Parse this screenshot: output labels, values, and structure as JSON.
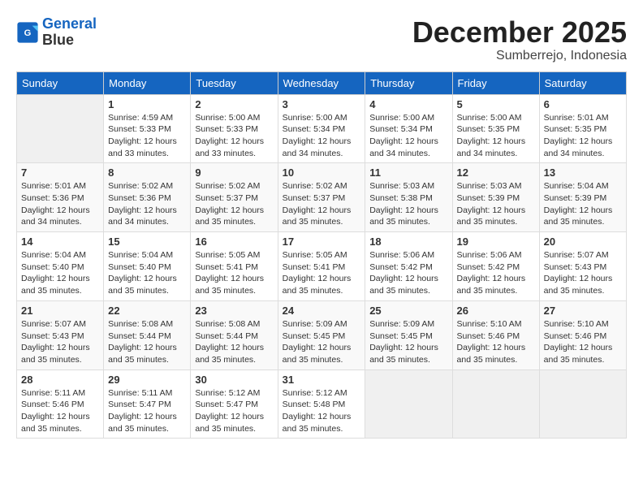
{
  "header": {
    "logo_line1": "General",
    "logo_line2": "Blue",
    "title": "December 2025",
    "subtitle": "Sumberrejo, Indonesia"
  },
  "weekdays": [
    "Sunday",
    "Monday",
    "Tuesday",
    "Wednesday",
    "Thursday",
    "Friday",
    "Saturday"
  ],
  "weeks": [
    [
      {
        "day": "",
        "info": ""
      },
      {
        "day": "1",
        "info": "Sunrise: 4:59 AM\nSunset: 5:33 PM\nDaylight: 12 hours\nand 33 minutes."
      },
      {
        "day": "2",
        "info": "Sunrise: 5:00 AM\nSunset: 5:33 PM\nDaylight: 12 hours\nand 33 minutes."
      },
      {
        "day": "3",
        "info": "Sunrise: 5:00 AM\nSunset: 5:34 PM\nDaylight: 12 hours\nand 34 minutes."
      },
      {
        "day": "4",
        "info": "Sunrise: 5:00 AM\nSunset: 5:34 PM\nDaylight: 12 hours\nand 34 minutes."
      },
      {
        "day": "5",
        "info": "Sunrise: 5:00 AM\nSunset: 5:35 PM\nDaylight: 12 hours\nand 34 minutes."
      },
      {
        "day": "6",
        "info": "Sunrise: 5:01 AM\nSunset: 5:35 PM\nDaylight: 12 hours\nand 34 minutes."
      }
    ],
    [
      {
        "day": "7",
        "info": "Sunrise: 5:01 AM\nSunset: 5:36 PM\nDaylight: 12 hours\nand 34 minutes."
      },
      {
        "day": "8",
        "info": "Sunrise: 5:02 AM\nSunset: 5:36 PM\nDaylight: 12 hours\nand 34 minutes."
      },
      {
        "day": "9",
        "info": "Sunrise: 5:02 AM\nSunset: 5:37 PM\nDaylight: 12 hours\nand 35 minutes."
      },
      {
        "day": "10",
        "info": "Sunrise: 5:02 AM\nSunset: 5:37 PM\nDaylight: 12 hours\nand 35 minutes."
      },
      {
        "day": "11",
        "info": "Sunrise: 5:03 AM\nSunset: 5:38 PM\nDaylight: 12 hours\nand 35 minutes."
      },
      {
        "day": "12",
        "info": "Sunrise: 5:03 AM\nSunset: 5:39 PM\nDaylight: 12 hours\nand 35 minutes."
      },
      {
        "day": "13",
        "info": "Sunrise: 5:04 AM\nSunset: 5:39 PM\nDaylight: 12 hours\nand 35 minutes."
      }
    ],
    [
      {
        "day": "14",
        "info": "Sunrise: 5:04 AM\nSunset: 5:40 PM\nDaylight: 12 hours\nand 35 minutes."
      },
      {
        "day": "15",
        "info": "Sunrise: 5:04 AM\nSunset: 5:40 PM\nDaylight: 12 hours\nand 35 minutes."
      },
      {
        "day": "16",
        "info": "Sunrise: 5:05 AM\nSunset: 5:41 PM\nDaylight: 12 hours\nand 35 minutes."
      },
      {
        "day": "17",
        "info": "Sunrise: 5:05 AM\nSunset: 5:41 PM\nDaylight: 12 hours\nand 35 minutes."
      },
      {
        "day": "18",
        "info": "Sunrise: 5:06 AM\nSunset: 5:42 PM\nDaylight: 12 hours\nand 35 minutes."
      },
      {
        "day": "19",
        "info": "Sunrise: 5:06 AM\nSunset: 5:42 PM\nDaylight: 12 hours\nand 35 minutes."
      },
      {
        "day": "20",
        "info": "Sunrise: 5:07 AM\nSunset: 5:43 PM\nDaylight: 12 hours\nand 35 minutes."
      }
    ],
    [
      {
        "day": "21",
        "info": "Sunrise: 5:07 AM\nSunset: 5:43 PM\nDaylight: 12 hours\nand 35 minutes."
      },
      {
        "day": "22",
        "info": "Sunrise: 5:08 AM\nSunset: 5:44 PM\nDaylight: 12 hours\nand 35 minutes."
      },
      {
        "day": "23",
        "info": "Sunrise: 5:08 AM\nSunset: 5:44 PM\nDaylight: 12 hours\nand 35 minutes."
      },
      {
        "day": "24",
        "info": "Sunrise: 5:09 AM\nSunset: 5:45 PM\nDaylight: 12 hours\nand 35 minutes."
      },
      {
        "day": "25",
        "info": "Sunrise: 5:09 AM\nSunset: 5:45 PM\nDaylight: 12 hours\nand 35 minutes."
      },
      {
        "day": "26",
        "info": "Sunrise: 5:10 AM\nSunset: 5:46 PM\nDaylight: 12 hours\nand 35 minutes."
      },
      {
        "day": "27",
        "info": "Sunrise: 5:10 AM\nSunset: 5:46 PM\nDaylight: 12 hours\nand 35 minutes."
      }
    ],
    [
      {
        "day": "28",
        "info": "Sunrise: 5:11 AM\nSunset: 5:46 PM\nDaylight: 12 hours\nand 35 minutes."
      },
      {
        "day": "29",
        "info": "Sunrise: 5:11 AM\nSunset: 5:47 PM\nDaylight: 12 hours\nand 35 minutes."
      },
      {
        "day": "30",
        "info": "Sunrise: 5:12 AM\nSunset: 5:47 PM\nDaylight: 12 hours\nand 35 minutes."
      },
      {
        "day": "31",
        "info": "Sunrise: 5:12 AM\nSunset: 5:48 PM\nDaylight: 12 hours\nand 35 minutes."
      },
      {
        "day": "",
        "info": ""
      },
      {
        "day": "",
        "info": ""
      },
      {
        "day": "",
        "info": ""
      }
    ]
  ]
}
